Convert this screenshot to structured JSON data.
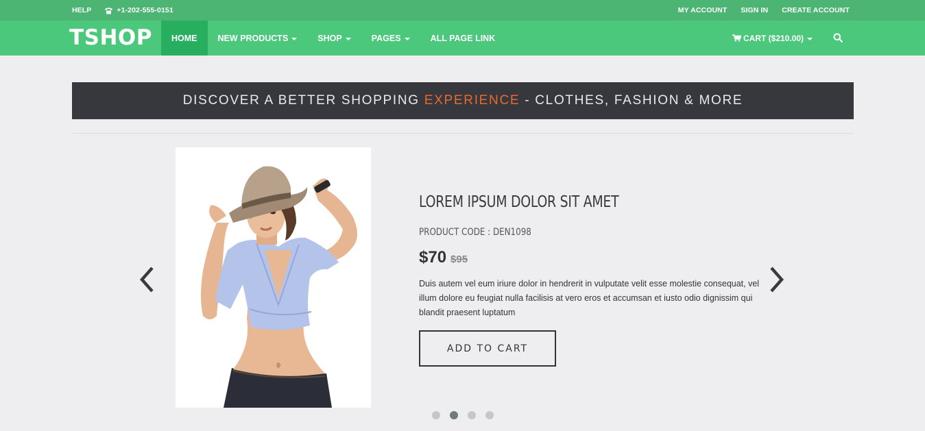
{
  "topbar": {
    "help": "HELP",
    "phone": "+1-202-555-0151",
    "my_account": "MY ACCOUNT",
    "sign_in": "SIGN IN",
    "create_account": "CREATE ACCOUNT",
    "phone_icon": "phone-icon"
  },
  "nav": {
    "logo": "TSHOP",
    "items": [
      {
        "label": "HOME",
        "active": true
      },
      {
        "label": "NEW PRODUCTS",
        "dropdown": true
      },
      {
        "label": "SHOP",
        "dropdown": true
      },
      {
        "label": "PAGES",
        "dropdown": true
      },
      {
        "label": "ALL PAGE LINK"
      }
    ],
    "cart": "CART ($210.00)",
    "cart_icon": "cart-icon",
    "search_icon": "search-icon"
  },
  "banner": {
    "before": "DISCOVER A BETTER SHOPPING ",
    "accent": "EXPERIENCE",
    "after": " - CLOTHES, FASHION & MORE"
  },
  "product": {
    "title": "LOREM IPSUM DOLOR SIT AMET",
    "code": "PRODUCT CODE : DEN1098",
    "price": "$70",
    "old_price": "$95",
    "description": "Duis autem vel eum iriure dolor in hendrerit in vulputate velit esse molestie consequat, vel illum dolore eu feugiat nulla facilisis at vero eros et accumsan et iusto odio dignissim qui blandit praesent luptatum",
    "add_to_cart": "ADD TO CART"
  },
  "slider": {
    "slide_count": 4,
    "active_index": 1
  },
  "colors": {
    "topbar": "#4cb574",
    "navbar": "#4cc87c",
    "nav_active": "#27ae5f",
    "banner_bg": "#36383d",
    "accent": "#e8692e"
  }
}
